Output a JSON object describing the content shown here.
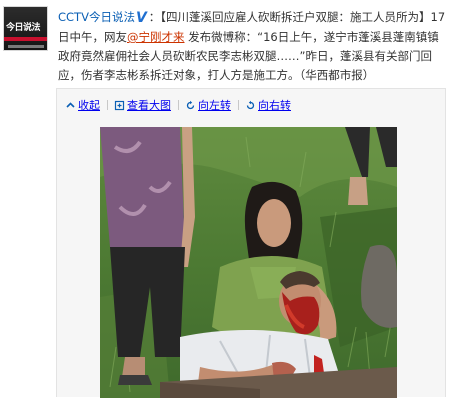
{
  "post": {
    "author": "CCTV今日说法",
    "verified_mark": "V",
    "colon": "：",
    "text_part1": "【四川蓬溪回应雇人砍断拆迁户双腿：施工人员所为】17日中午，网友",
    "mention": "@宁刚才来",
    "text_part2": " 发布微博称：“16日上午，遂宁市蓬溪县蓬南镇镇政府竟然雇佣社会人员砍断农民李志彬双腿……”昨日，蓬溪县有关部门回应，伤者李志彬系拆迁对象，打人方是施工方。（华西都市报）"
  },
  "avatar": {
    "logo_text": "今日说法"
  },
  "media_toolbar": {
    "collapse": "收起",
    "view_large": "查看大图",
    "rotate_left": "向左转",
    "rotate_right": "向右转"
  },
  "colors": {
    "link": "#0a5fb4",
    "mention": "#cc3300",
    "verified": "#1f6fd0",
    "accent_red": "#c8102e"
  }
}
